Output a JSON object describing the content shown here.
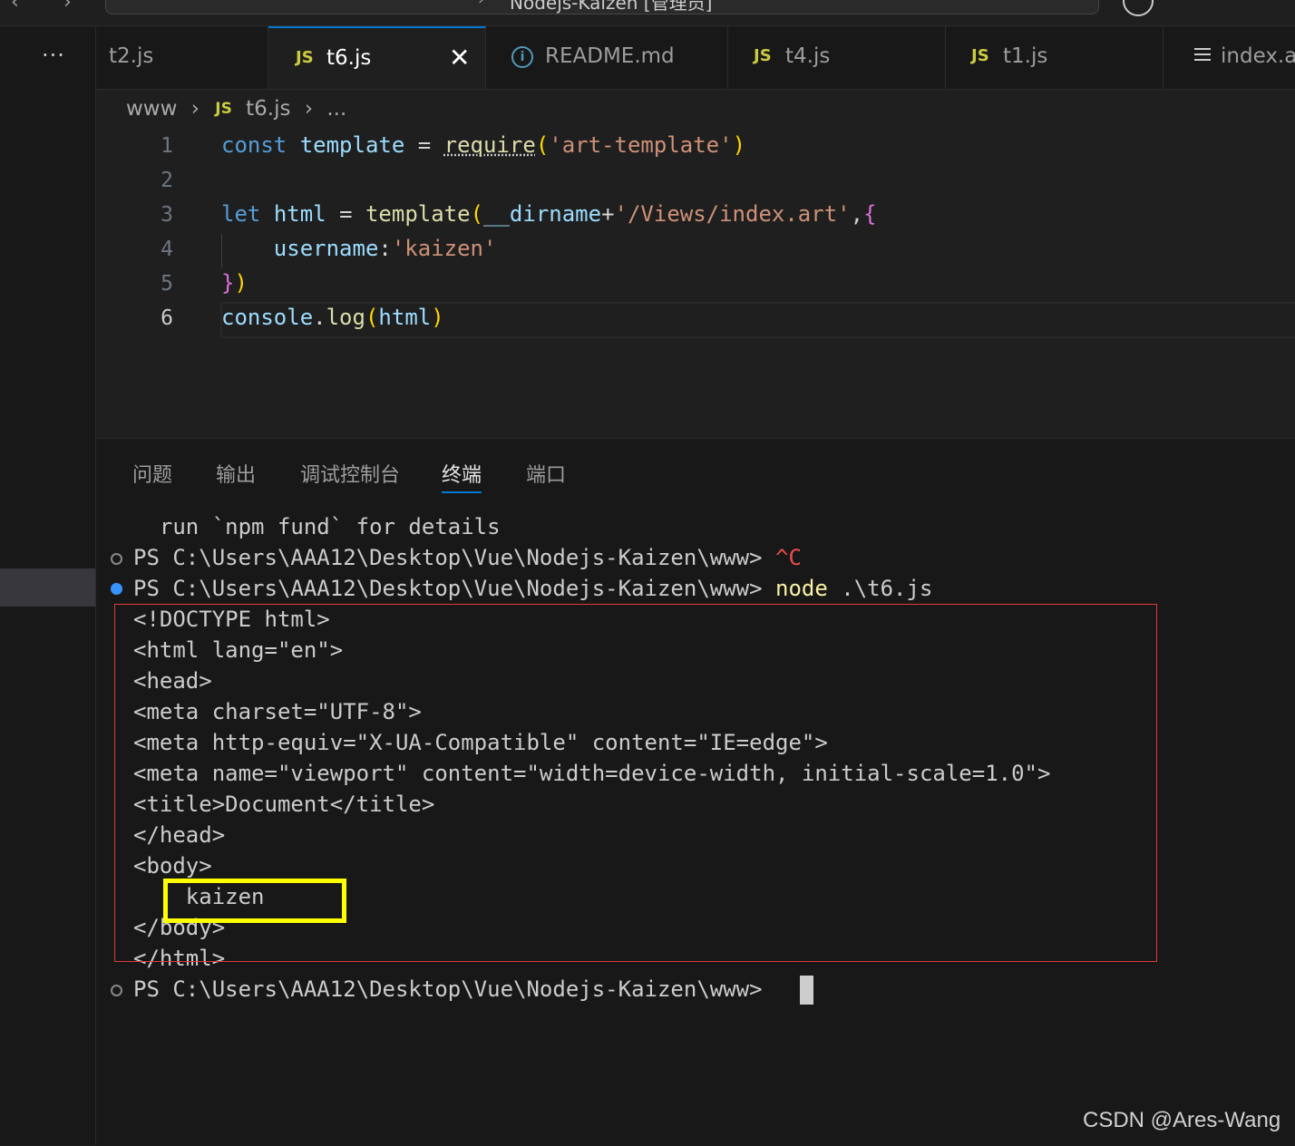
{
  "window": {
    "title": "Nodejs-Kaizen [管理员]"
  },
  "activity_bar": {
    "more_label": "···"
  },
  "tabs": [
    {
      "label": "t2.js",
      "icon": "none",
      "active": false
    },
    {
      "label": "t6.js",
      "icon": "JS",
      "active": true,
      "close": "✕"
    },
    {
      "label": "README.md",
      "icon": "info-icon",
      "active": false
    },
    {
      "label": "t4.js",
      "icon": "JS",
      "active": false
    },
    {
      "label": "t1.js",
      "icon": "JS",
      "active": false
    },
    {
      "label": "index.a",
      "icon": "list-icon",
      "active": false
    }
  ],
  "breadcrumb": {
    "folder": "www",
    "js_badge": "JS",
    "file": "t6.js",
    "ellipsis": "..."
  },
  "editor": {
    "line_numbers": [
      "1",
      "2",
      "3",
      "4",
      "5",
      "6"
    ],
    "current_line": "6",
    "code": {
      "l1_const": "const",
      "l1_name": "template",
      "l1_eq": "=",
      "l1_fn": "require",
      "l1_arg": "'art-template'",
      "l3_let": "let",
      "l3_name": "html",
      "l3_eq": "=",
      "l3_fn": "template",
      "l3_dir": "__dirname",
      "l3_plus": "+",
      "l3_str": "'/Views/index.art'",
      "l4_key": "username",
      "l4_colon": ":",
      "l4_val": "'kaizen'",
      "l6_obj": "console",
      "l6_dot": ".",
      "l6_fn": "log",
      "l6_arg": "html"
    }
  },
  "panel": {
    "tabs": [
      "问题",
      "输出",
      "调试控制台",
      "终端",
      "端口"
    ],
    "active_tab": "终端"
  },
  "terminal": {
    "line_fund": "  run `npm fund` for details",
    "prompt": "PS C:\\Users\\AAA12\\Desktop\\Vue\\Nodejs-Kaizen\\www> ",
    "ctrl_c": "^C",
    "cmd_node": "node",
    "cmd_arg": " .\\t6.js",
    "output": [
      "<!DOCTYPE html>",
      "<html lang=\"en\">",
      "<head>",
      "<meta charset=\"UTF-8\">",
      "<meta http-equiv=\"X-UA-Compatible\" content=\"IE=edge\">",
      "<meta name=\"viewport\" content=\"width=device-width, initial-scale=1.0\">",
      "<title>Document</title>",
      "</head>",
      "<body>",
      "    kaizen",
      "</body>",
      "</html>"
    ]
  },
  "annotation_colors": {
    "red_box": "#e03a3a",
    "yellow_box": "#ffff00"
  },
  "watermark": "CSDN @Ares-Wang"
}
